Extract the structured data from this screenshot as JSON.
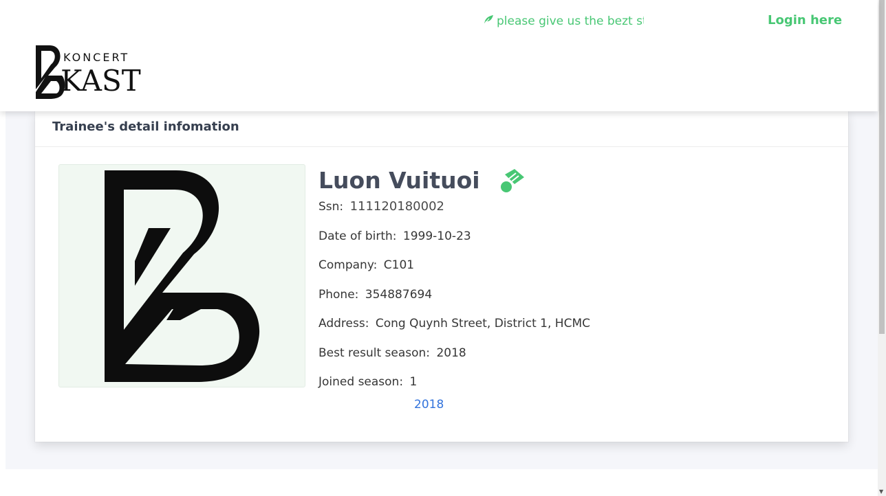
{
  "header": {
    "marquee_text": "please give us the bezt star",
    "login_label": "Login here",
    "logo": {
      "top_text": "KONCERT",
      "main_text": "KAST"
    }
  },
  "card": {
    "title": "Trainee's detail infomation",
    "trainee": {
      "name": "Luon Vuituoi",
      "ssn_label": "Ssn:",
      "ssn": "111120180002",
      "dob_label": "Date of birth:",
      "dob": "1999-10-23",
      "company_label": "Company:",
      "company": "C101",
      "phone_label": "Phone:",
      "phone": "354887694",
      "address_label": "Address:",
      "address": "Cong Quynh Street, District 1, HCMC",
      "best_label": "Best result season:",
      "best": "2018",
      "joined_label": "Joined season:",
      "joined": "1",
      "season_link": "2018"
    }
  },
  "colors": {
    "accent": "#48c774",
    "link": "#3273dc",
    "background": "#f5f6fa"
  },
  "icons": [
    "leaf-icon",
    "award-badge-icon",
    "brand-logo-icon"
  ]
}
